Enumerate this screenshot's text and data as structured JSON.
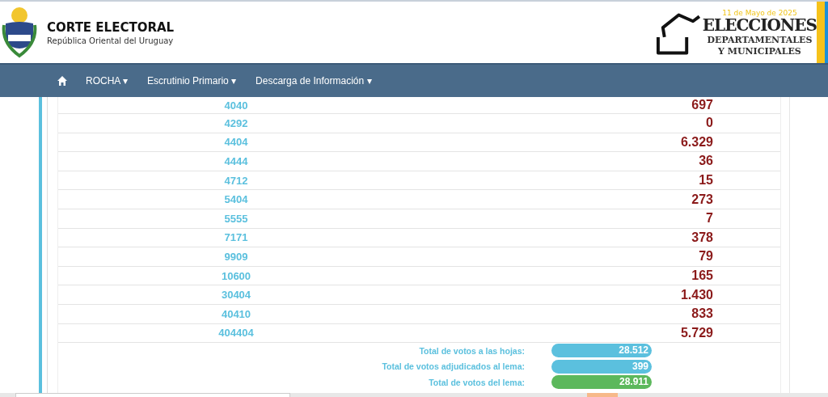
{
  "header": {
    "title": "CORTE ELECTORAL",
    "subtitle": "República Oriental del Uruguay",
    "banner": {
      "date": "11 de Mayo de 2025",
      "line_1": "ELECCIONES",
      "line_2": "DEPARTAMENTALES",
      "line_3": "Y MUNICIPALES"
    }
  },
  "nav": {
    "items": [
      {
        "label": "ROCHA",
        "caret": "▾"
      },
      {
        "label": "Escrutinio Primario",
        "caret": "▾"
      },
      {
        "label": "Descarga de Información",
        "caret": "▾"
      }
    ]
  },
  "table": {
    "rows": [
      {
        "list": "4040",
        "votes": "697"
      },
      {
        "list": "4292",
        "votes": "0"
      },
      {
        "list": "4404",
        "votes": "6.329"
      },
      {
        "list": "4444",
        "votes": "36"
      },
      {
        "list": "4712",
        "votes": "15"
      },
      {
        "list": "5404",
        "votes": "273"
      },
      {
        "list": "5555",
        "votes": "7"
      },
      {
        "list": "7171",
        "votes": "378"
      },
      {
        "list": "9909",
        "votes": "79"
      },
      {
        "list": "10600",
        "votes": "165"
      },
      {
        "list": "30404",
        "votes": "1.430"
      },
      {
        "list": "40410",
        "votes": "833"
      },
      {
        "list": "404404",
        "votes": "5.729"
      }
    ]
  },
  "totals": [
    {
      "label": "Total de votos a las hojas:",
      "value": "28.512",
      "color": "#5bc0de"
    },
    {
      "label": "Total de votos adjudicados al lema:",
      "value": "399",
      "color": "#5bc0de"
    },
    {
      "label": "Total de votos del lema:",
      "value": "28.911",
      "color": "#5cb85c"
    }
  ]
}
